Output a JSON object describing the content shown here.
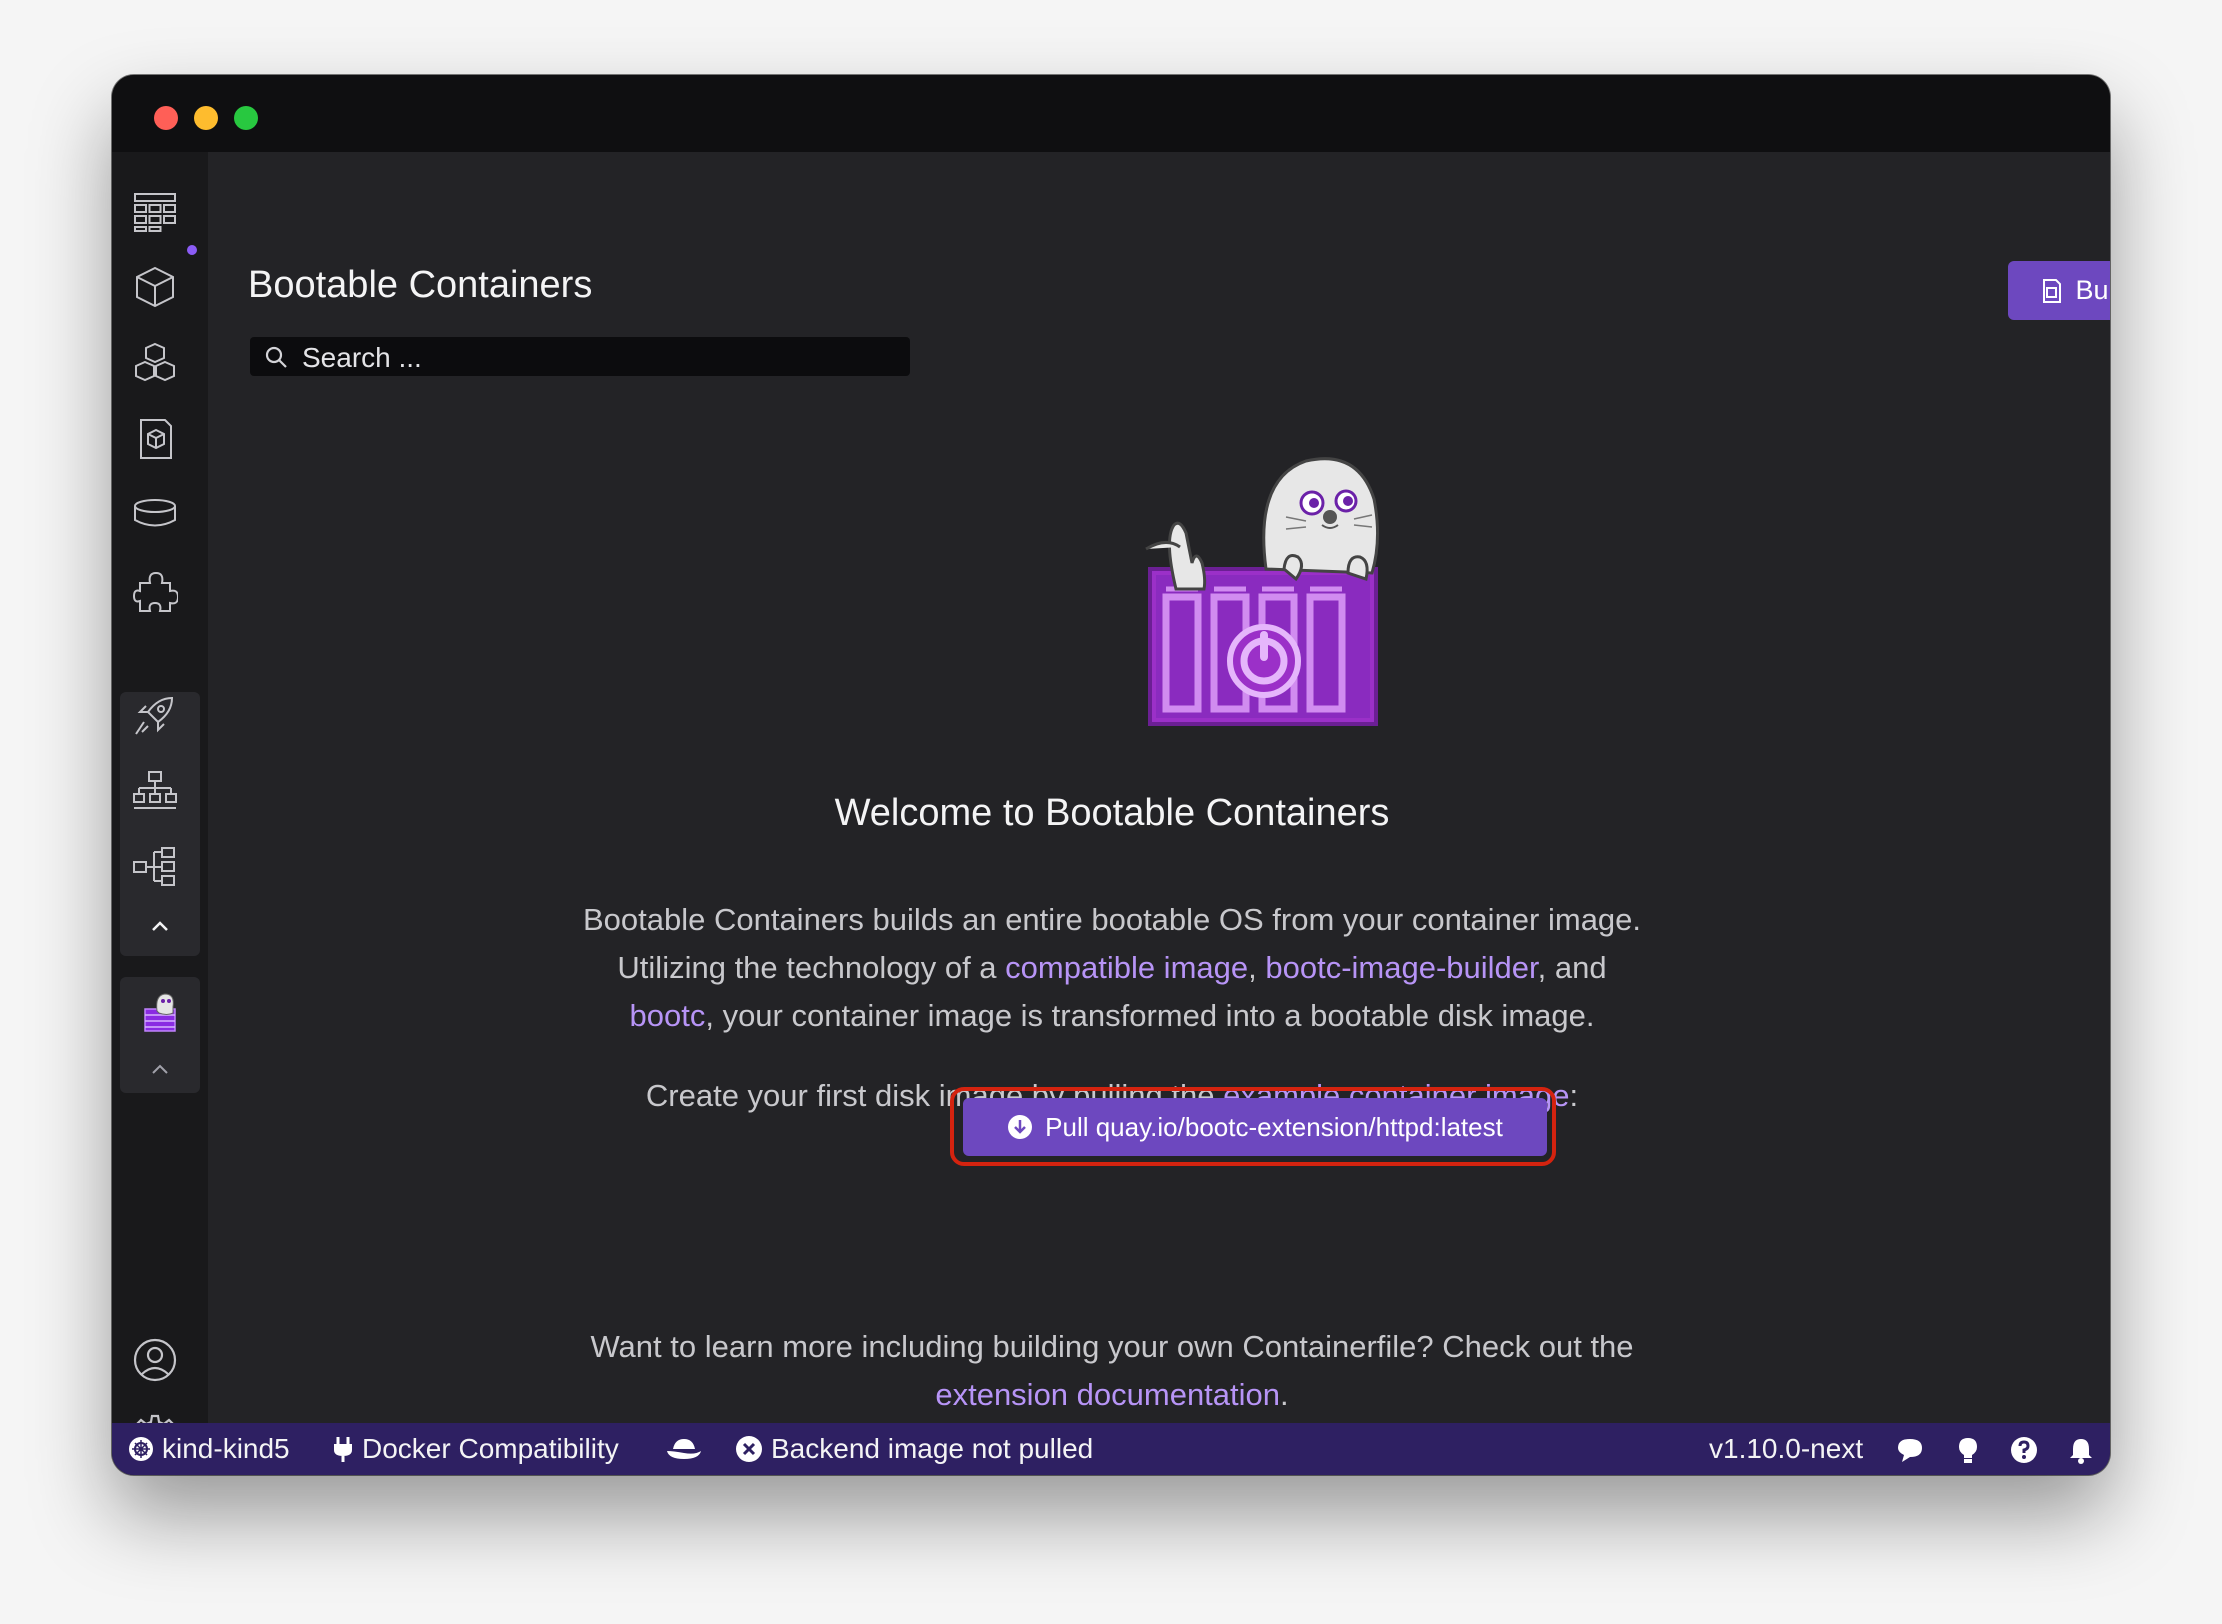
{
  "page": {
    "title": "Bootable Containers",
    "build_label": "Build"
  },
  "search": {
    "placeholder": "Search ..."
  },
  "welcome": {
    "heading": "Welcome to Bootable Containers",
    "intro_line1": "Bootable Containers builds an entire bootable OS from your container image.",
    "intro_line2_prefix": "Utilizing the technology of a ",
    "link_compatible_image": "compatible image",
    "sep_comma": ", ",
    "link_bootc_image_builder": "bootc-image-builder",
    "intro_line2_suffix": ", and",
    "link_bootc": "bootc",
    "intro_line3_suffix": ", your container image is transformed into a bootable disk image.",
    "create_prefix": "Create your first disk image by pulling the ",
    "link_example_image": "example container image",
    "create_suffix": ":",
    "pull_button_label": "Pull quay.io/bootc-extension/httpd:latest",
    "learn_line1": "Want to learn more including building your own Containerfile? Check out the",
    "link_extension_docs": "extension documentation",
    "learn_suffix": "."
  },
  "sidebar": {
    "items": [
      {
        "icon": "dashboard-icon"
      },
      {
        "icon": "container-icon"
      },
      {
        "icon": "pods-icon"
      },
      {
        "icon": "images-icon"
      },
      {
        "icon": "volumes-icon"
      },
      {
        "icon": "extensions-icon"
      },
      {
        "icon": "deployments-icon"
      },
      {
        "icon": "services-icon"
      },
      {
        "icon": "kubernetes-icon"
      },
      {
        "icon": "bootc-extension-icon"
      }
    ],
    "bottom": [
      {
        "icon": "account-icon"
      },
      {
        "icon": "settings-icon"
      }
    ]
  },
  "statusbar": {
    "context": "kind-kind5",
    "docker_compat": "Docker Compatibility",
    "backend_status": "Backend image not pulled",
    "version": "v1.10.0-next"
  },
  "colors": {
    "accent": "#6d48bf",
    "link": "#b794f6",
    "statusbar": "#2e2062",
    "highlight": "#d4230f"
  }
}
